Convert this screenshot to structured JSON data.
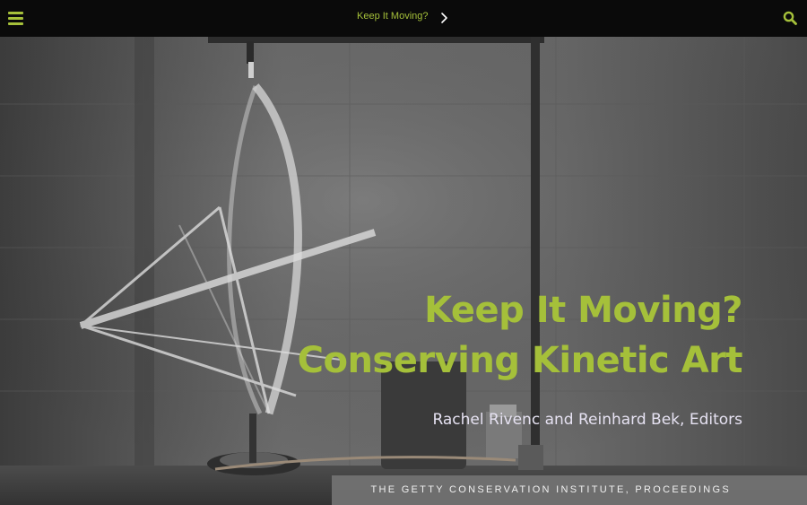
{
  "topbar": {
    "menu_icon": "hamburger-menu-icon",
    "nav_title": "Keep It Moving?",
    "next_icon": "chevron-right-icon",
    "search_icon": "search-icon"
  },
  "hero": {
    "title_line1": "Keep It Moving?",
    "title_line2": "Conserving Kinetic Art",
    "editors": "Rachel Rivenc and Reinhard Bek, Editors",
    "publisher": "THE GETTY CONSERVATION INSTITUTE, PROCEEDINGS",
    "image_subject": "kinetic-sculpture-photo"
  },
  "colors": {
    "accent": "#a5c03a",
    "topbar_bg": "#0a0a0a",
    "editors_text": "#e6e2f2",
    "footer_band": "#737373"
  }
}
